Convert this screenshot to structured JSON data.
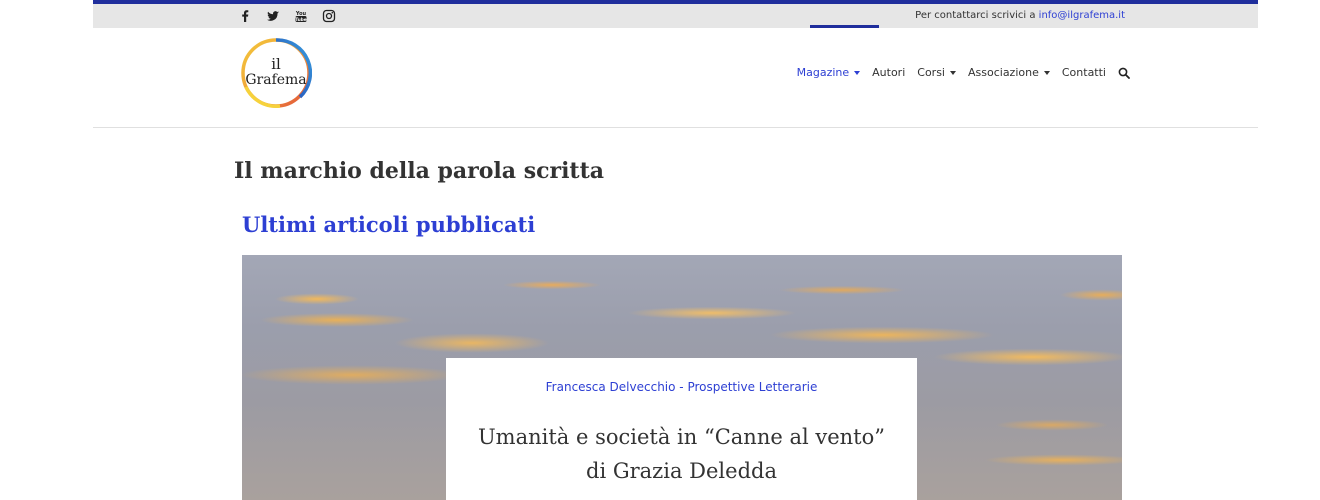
{
  "topbar": {
    "social_icons": [
      "facebook-icon",
      "twitter-icon",
      "youtube-icon",
      "instagram-icon"
    ],
    "contact_text": "Per contattarci scrivici a ",
    "contact_email": "info@ilgrafema.it"
  },
  "logo": {
    "line1": "il",
    "line2": "Grafema"
  },
  "menu": {
    "items": [
      {
        "label": "Magazine",
        "has_dropdown": true,
        "active": true
      },
      {
        "label": "Autori",
        "has_dropdown": false
      },
      {
        "label": "Corsi",
        "has_dropdown": true
      },
      {
        "label": "Associazione",
        "has_dropdown": true
      },
      {
        "label": "Contatti",
        "has_dropdown": false
      }
    ],
    "search_icon": "search-icon"
  },
  "content": {
    "tagline": "Il marchio della parola scritta",
    "section_title": "Ultimi articoli pubblicati",
    "featured": {
      "meta": "Francesca Delvecchio - Prospettive Letterarie",
      "title": "Umanità e società in “Canne al vento” di Grazia Deledda"
    }
  },
  "colors": {
    "accent": "#2d3fd3",
    "topbar_border": "#1f2e9c",
    "topbar_bg": "#e6e6e6"
  }
}
